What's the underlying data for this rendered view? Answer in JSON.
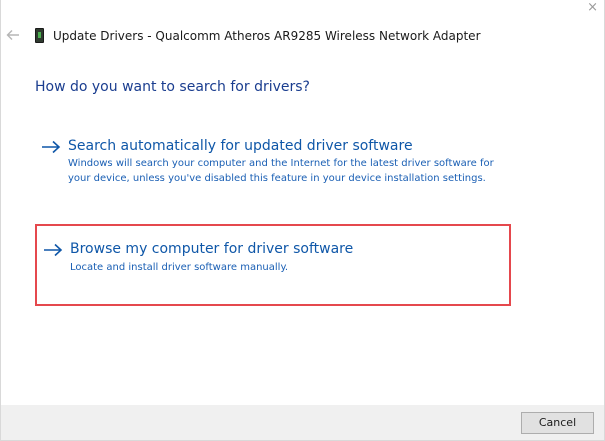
{
  "window": {
    "title": "Update Drivers - Qualcomm Atheros AR9285 Wireless Network Adapter",
    "close_glyph": "×",
    "back_icon": "back-arrow-icon",
    "device_icon": "network-adapter-icon"
  },
  "main": {
    "heading": "How do you want to search for drivers?",
    "options": [
      {
        "title": "Search automatically for updated driver software",
        "description": "Windows will search your computer and the Internet for the latest driver software for your device, unless you've disabled this feature in your device installation settings."
      },
      {
        "title": "Browse my computer for driver software",
        "description": "Locate and install driver software manually."
      }
    ],
    "highlight_color": "#e5484d",
    "link_color": "#0f57a8"
  },
  "footer": {
    "cancel_label": "Cancel"
  }
}
